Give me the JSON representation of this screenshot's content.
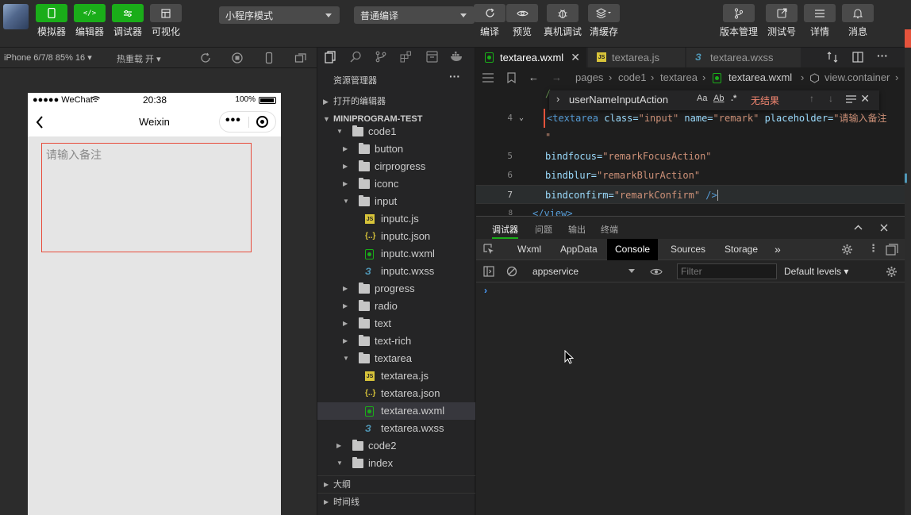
{
  "toolbar": {
    "simulator": "模拟器",
    "editor": "编辑器",
    "debugger": "调试器",
    "visual": "可视化",
    "mode_select": "小程序模式",
    "compile_select": "普通编译",
    "compile": "编译",
    "preview": "预览",
    "real_debug": "真机调试",
    "clear_cache": "清缓存",
    "version_mgmt": "版本管理",
    "test_account": "测试号",
    "details": "详情",
    "messages": "消息",
    "colors": {
      "green": "#1aad19",
      "gray": "#4a4a4a"
    }
  },
  "simulator": {
    "device": "iPhone 6/7/8 85% 16 ▾",
    "hot_reload": "热重载 开 ▾",
    "status": {
      "carrier": "●●●●● WeChat",
      "time": "20:38",
      "battery": "100%"
    },
    "nav_title": "Weixin",
    "textarea_placeholder": "请输入备注"
  },
  "explorer": {
    "title": "资源管理器",
    "open_editors": "打开的编辑器",
    "project": "MINIPROGRAM-TEST",
    "tree": [
      {
        "name": "code1",
        "type": "folder",
        "open": true,
        "depth": 1
      },
      {
        "name": "button",
        "type": "folder",
        "open": false,
        "depth": 2
      },
      {
        "name": "cirprogress",
        "type": "folder",
        "open": false,
        "depth": 2
      },
      {
        "name": "iconc",
        "type": "folder",
        "open": false,
        "depth": 2
      },
      {
        "name": "input",
        "type": "folder",
        "open": true,
        "depth": 2
      },
      {
        "name": "inputc.js",
        "type": "js",
        "depth": 3
      },
      {
        "name": "inputc.json",
        "type": "json",
        "depth": 3
      },
      {
        "name": "inputc.wxml",
        "type": "wxml",
        "depth": 3
      },
      {
        "name": "inputc.wxss",
        "type": "wxss",
        "depth": 3
      },
      {
        "name": "progress",
        "type": "folder",
        "open": false,
        "depth": 2
      },
      {
        "name": "radio",
        "type": "folder",
        "open": false,
        "depth": 2
      },
      {
        "name": "text",
        "type": "folder",
        "open": false,
        "depth": 2
      },
      {
        "name": "text-rich",
        "type": "folder",
        "open": false,
        "depth": 2
      },
      {
        "name": "textarea",
        "type": "folder",
        "open": true,
        "depth": 2
      },
      {
        "name": "textarea.js",
        "type": "js",
        "depth": 3
      },
      {
        "name": "textarea.json",
        "type": "json",
        "depth": 3
      },
      {
        "name": "textarea.wxml",
        "type": "wxml",
        "depth": 3,
        "selected": true
      },
      {
        "name": "textarea.wxss",
        "type": "wxss",
        "depth": 3
      },
      {
        "name": "code2",
        "type": "folder",
        "open": false,
        "depth": 1
      },
      {
        "name": "index",
        "type": "folder",
        "open": true,
        "depth": 1
      }
    ],
    "outline": "大纲",
    "timeline": "时间线"
  },
  "editor": {
    "tabs": [
      {
        "label": "textarea.wxml",
        "active": true,
        "close": "✕"
      },
      {
        "label": "textarea.js"
      },
      {
        "label": "textarea.wxss"
      }
    ],
    "breadcrumb": [
      "pages",
      "code1",
      "textarea",
      "textarea.wxml",
      "view.container"
    ],
    "find": {
      "query": "userNameInputAction",
      "opt_case": "Aa",
      "opt_word": "Ab",
      "opt_regex": ".*",
      "no_results": "无结果"
    },
    "lines": {
      "l4": {
        "num": "4",
        "tag": "<textarea",
        "a1": " class=",
        "v1": "\"input\"",
        "a2": " name=",
        "v2": "\"remark\"",
        "a3": " placeholder=",
        "v3": "\"请输入备注"
      },
      "l4b": {
        "text": "\""
      },
      "l5": {
        "num": "5",
        "attr": "bindfocus=",
        "val": "\"remarkFocusAction\""
      },
      "l6": {
        "num": "6",
        "attr": "bindblur=",
        "val": "\"remarkBlurAction\""
      },
      "l7": {
        "num": "7",
        "attr": "bindconfirm=",
        "val": "\"remarkConfirm\"",
        "end": " />"
      },
      "l8": {
        "num": "8",
        "text": "</view>"
      }
    }
  },
  "debugger": {
    "panel_tabs": [
      "调试器",
      "问题",
      "输出",
      "终端"
    ],
    "devtools_tabs": [
      "Wxml",
      "AppData",
      "Console",
      "Sources",
      "Storage",
      "»"
    ],
    "context": "appservice",
    "filter_placeholder": "Filter",
    "levels": "Default levels ▾",
    "prompt": "›"
  }
}
